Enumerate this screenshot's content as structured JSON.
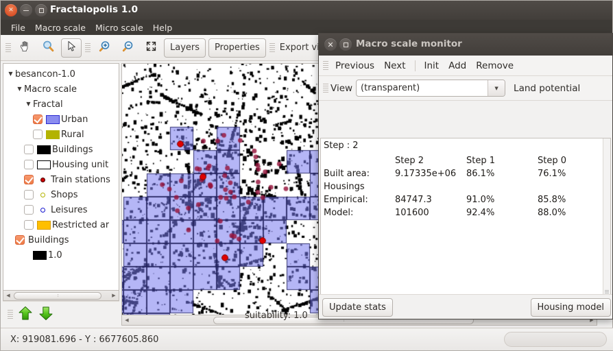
{
  "main_window": {
    "title": "Fractalopolis 1.0",
    "controls": [
      {
        "name": "close",
        "glyph": "×"
      },
      {
        "name": "minimize",
        "glyph": "–"
      },
      {
        "name": "maximize",
        "glyph": "□"
      }
    ],
    "menus": [
      "File",
      "Macro scale",
      "Micro scale",
      "Help"
    ],
    "toolbar": {
      "pan_icon": "hand-icon",
      "zoom_icon": "magnifier-icon",
      "select_icon": "cursor-arrow-icon",
      "zoom_in_icon": "magnifier-plus-icon",
      "zoom_out_icon": "magnifier-minus-icon",
      "fit_icon": "fit-to-screen-icon",
      "layers_label": "Layers",
      "properties_label": "Properties",
      "export_label": "Export vie"
    }
  },
  "sidebar": {
    "tree": [
      {
        "label": "besancon-1.0",
        "depth": 0,
        "expander": "▼",
        "kind": "node"
      },
      {
        "label": "Macro scale",
        "depth": 1,
        "expander": "▼",
        "kind": "node"
      },
      {
        "label": "Fractal",
        "depth": 2,
        "expander": "▼",
        "kind": "node"
      },
      {
        "label": "Urban",
        "depth": 3,
        "checked": true,
        "kind": "fill",
        "fill": "#8a8cf0",
        "stroke": "#2a2ad0"
      },
      {
        "label": "Rural",
        "depth": 3,
        "checked": false,
        "kind": "fill",
        "fill": "#b3b300",
        "stroke": "#b3b300"
      },
      {
        "label": "Buildings",
        "depth": 2,
        "checked": false,
        "kind": "fill",
        "fill": "#000000",
        "stroke": "#000000"
      },
      {
        "label": "Housing unit",
        "depth": 2,
        "checked": false,
        "kind": "fill",
        "fill": "#ffffff",
        "stroke": "#000000"
      },
      {
        "label": "Train stations",
        "depth": 2,
        "checked": true,
        "kind": "dot",
        "fill": "#cc0000",
        "stroke": "#440000"
      },
      {
        "label": "Shops",
        "depth": 2,
        "checked": false,
        "kind": "dot",
        "fill": "#ffffff",
        "stroke": "#b3b300"
      },
      {
        "label": "Leisures",
        "depth": 2,
        "checked": false,
        "kind": "dot",
        "fill": "#ffffff",
        "stroke": "#1414d0"
      },
      {
        "label": "Restricted ar",
        "depth": 2,
        "checked": false,
        "kind": "fill",
        "fill": "#ffbf00",
        "stroke": "#d89b00"
      },
      {
        "label": "Buildings",
        "depth": 1,
        "checked": true,
        "kind": "none"
      },
      {
        "label": "1.0",
        "depth": 3,
        "kind": "fill",
        "fill": "#000000",
        "stroke": "#000000"
      }
    ],
    "move_up_icon": "arrow-up-icon",
    "move_down_icon": "arrow-down-icon"
  },
  "statusbar": {
    "coords": "X: 919081.696 - Y : 6677605.860"
  },
  "map": {
    "occluded_label": "suitability: 1.0"
  },
  "monitor_dialog": {
    "title": "Macro scale monitor",
    "controls": [
      {
        "name": "close",
        "glyph": "×"
      },
      {
        "name": "maximize",
        "glyph": "□"
      }
    ],
    "menus": [
      "Previous",
      "Next",
      "Init",
      "Add",
      "Remove"
    ],
    "view_label": "View",
    "view_value": "(transparent)",
    "land_potential_label": "Land potential",
    "step_line": "Step : 2",
    "columns": [
      "",
      "Step 2",
      "Step 1",
      "Step 0"
    ],
    "rows": [
      {
        "label": "Built area:",
        "values": [
          "9.17335e+06",
          "86.1%",
          "76.1%"
        ]
      },
      {
        "label": "Housings",
        "values": [
          "",
          "",
          ""
        ]
      },
      {
        "label": "Empirical:",
        "values": [
          "84747.3",
          "91.0%",
          "85.8%"
        ]
      },
      {
        "label": "Model:",
        "values": [
          "101600",
          "92.4%",
          "88.0%"
        ]
      }
    ],
    "update_stats_label": "Update stats",
    "housing_model_label": "Housing model"
  },
  "colors": {
    "accent_orange": "#ef7c46",
    "urban_blue": "#8a8cf0",
    "station_red": "#cc0000",
    "titlebar_dark": "#423e3a"
  }
}
